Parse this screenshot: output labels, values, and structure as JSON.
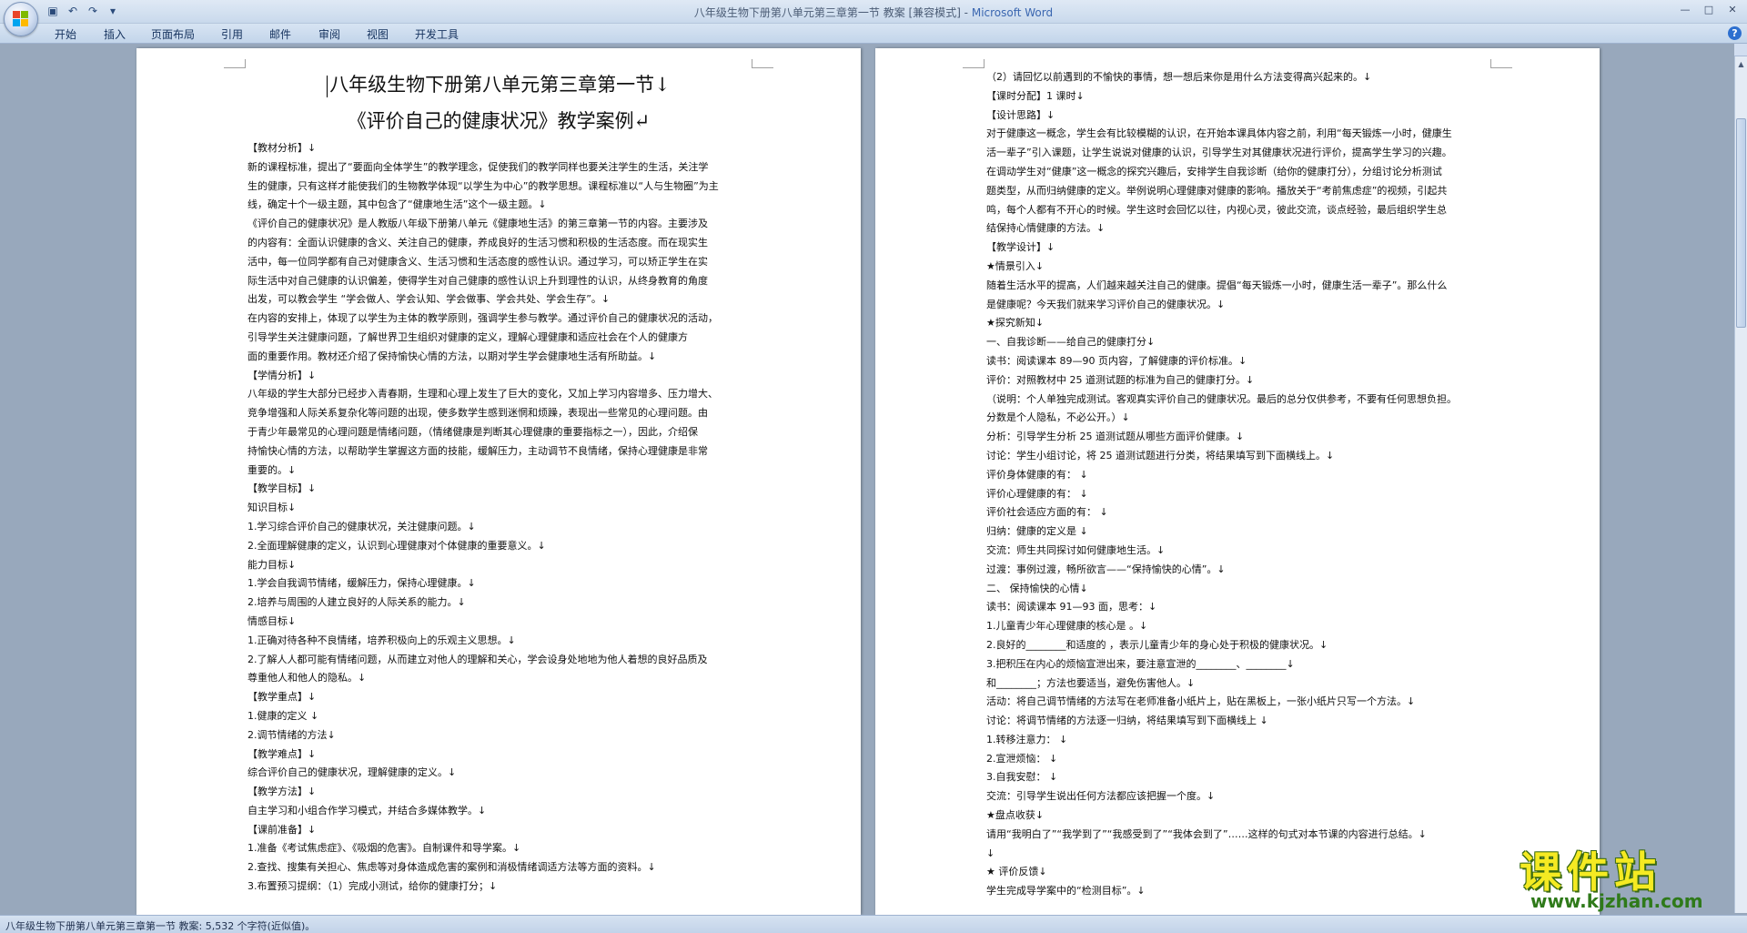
{
  "titlebar": {
    "title": "八年级生物下册第八单元第三章第一节 教案 [兼容模式] - ",
    "app": "Microsoft Word"
  },
  "icons": {
    "save": "save-icon",
    "undo": "undo-icon",
    "redo": "redo-icon",
    "customize": "chevron-down-icon",
    "help": "help-icon"
  },
  "tabs": [
    "开始",
    "插入",
    "页面布局",
    "引用",
    "邮件",
    "审阅",
    "视图",
    "开发工具"
  ],
  "page1": {
    "title_line1": "八年级生物下册第八单元第三章第一节↓",
    "title_line2": "《评价自己的健康状况》教学案例↵",
    "lines": [
      "【教材分析】↓",
      "新的课程标准，提出了“要面向全体学生”的教学理念，促使我们的教学同样也要关注学生的生活，关注学",
      "生的健康，只有这样才能使我们的生物教学体现“以学生为中心”的教学思想。课程标准以“人与生物圈”为主",
      "线，确定十个一级主题，其中包含了“健康地生活”这个一级主题。↓",
      "《评价自己的健康状况》是人教版八年级下册第八单元《健康地生活》的第三章第一节的内容。主要涉及",
      "的内容有：全面认识健康的含义、关注自己的健康，养成良好的生活习惯和积极的生活态度。而在现实生",
      "活中，每一位同学都有自己对健康含义、生活习惯和生活态度的感性认识。通过学习，可以矫正学生在实",
      "际生活中对自己健康的认识偏差，使得学生对自己健康的感性认识上升到理性的认识，从终身教育的角度",
      "出发，可以教会学生 “学会做人、学会认知、学会做事、学会共处、学会生存”。↓",
      "在内容的安排上，体现了以学生为主体的教学原则，强调学生参与教学。通过评价自己的健康状况的活动，",
      "引导学生关注健康问题，了解世界卫生组织对健康的定义，理解心理健康和适应社会在个人的健康方",
      "面的重要作用。教材还介绍了保持愉快心情的方法，以期对学生学会健康地生活有所助益。↓",
      "【学情分析】↓",
      "八年级的学生大部分已经步入青春期，生理和心理上发生了巨大的变化，又加上学习内容增多、压力增大、",
      "竞争增强和人际关系复杂化等问题的出现，使多数学生感到迷惘和烦躁，表现出一些常见的心理问题。由",
      "于青少年最常见的心理问题是情绪问题，（情绪健康是判断其心理健康的重要指标之一），因此，介绍保",
      "持愉快心情的方法，以帮助学生掌握这方面的技能，缓解压力，主动调节不良情绪，保持心理健康是非常",
      "重要的。↓",
      "【教学目标】↓",
      "知识目标↓",
      "1.学习综合评价自己的健康状况，关注健康问题。↓",
      "2.全面理解健康的定义，认识到心理健康对个体健康的重要意义。↓",
      "能力目标↓",
      "1.学会自我调节情绪，缓解压力，保持心理健康。↓",
      "2.培养与周围的人建立良好的人际关系的能力。↓",
      "情感目标↓",
      "1.正确对待各种不良情绪，培养积极向上的乐观主义思想。↓",
      "2.了解人人都可能有情绪问题，从而建立对他人的理解和关心，学会设身处地地为他人着想的良好品质及",
      "尊重他人和他人的隐私。↓",
      "【教学重点】↓",
      "1.健康的定义 ↓",
      "2.调节情绪的方法↓",
      "【教学难点】↓",
      "综合评价自己的健康状况，理解健康的定义。↓",
      "【教学方法】↓",
      "自主学习和小组合作学习模式，并结合多媒体教学。↓",
      "【课前准备】↓",
      "1.准备《考试焦虑症》、《吸烟的危害》。自制课件和导学案。↓",
      "2.查找、搜集有关担心、焦虑等对身体造成危害的案例和消极情绪调适方法等方面的资料。↓",
      "3.布置预习提纲：（1）完成小测试，给你的健康打分；↓"
    ]
  },
  "page2": {
    "lines": [
      "（2）请回忆以前遇到的不愉快的事情，想一想后来你是用什么方法变得高兴起来的。↓",
      "【课时分配】1 课时↓",
      "【设计思路】↓",
      "对于健康这一概念，学生会有比较模糊的认识，在开始本课具体内容之前，利用“每天锻炼一小时，健康生",
      "活一辈子”引入课题，让学生说说对健康的认识，引导学生对其健康状况进行评价，提高学生学习的兴趣。",
      "在调动学生对“健康”这一概念的探究兴趣后，安排学生自我诊断（给你的健康打分），分组讨论分析测试",
      "题类型，从而归纳健康的定义。举例说明心理健康对健康的影响。播放关于“考前焦虑症”的视频，引起共",
      "鸣，每个人都有不开心的时候。学生这时会回忆以往，内视心灵，彼此交流，谈点经验，最后组织学生总",
      "结保持心情健康的方法。↓",
      "【教学设计】↓",
      "★情景引入↓",
      "随着生活水平的提高，人们越来越关注自己的健康。提倡“每天锻炼一小时，健康生活一辈子”。那么什么",
      "是健康呢？今天我们就来学习评价自己的健康状况。↓",
      "★探究新知↓",
      "一、自我诊断——给自己的健康打分↓",
      "读书：阅读课本 89—90 页内容，了解健康的评价标准。↓",
      "评价：对照教材中 25 道测试题的标准为自己的健康打分。↓",
      "（说明：个人单独完成测试。客观真实评价自己的健康状况。最后的总分仅供参考，不要有任何思想负担。",
      "分数是个人隐私，不必公开。）↓",
      "分析：引导学生分析 25 道测试题从哪些方面评价健康。↓",
      "讨论：学生小组讨论，将 25 道测试题进行分类，将结果填写到下面横线上。↓",
      "评价身体健康的有： ↓",
      "评价心理健康的有： ↓",
      "    评价社会适应方面的有： ↓",
      "归纳：健康的定义是 ↓",
      "交流：师生共同探讨如何健康地生活。↓",
      "过渡：事例过渡，畅所欲言——“保持愉快的心情”。↓",
      "二、 保持愉快的心情↓",
      "读书：阅读课本 91—93 面，思考：↓",
      "1.儿童青少年心理健康的核心是 。↓",
      "2.良好的________和适度的 ，表示儿童青少年的身心处于积极的健康状况。↓",
      "3.把积压在内心的烦恼宣泄出来，要注意宣泄的________、________↓",
      "和________；方法也要适当，避免伤害他人。↓",
      "活动：将自己调节情绪的方法写在老师准备小纸片上，贴在黑板上，一张小纸片只写一个方法。↓",
      "讨论：将调节情绪的方法逐一归纳，将结果填写到下面横线上 ↓",
      "1.转移注意力： ↓",
      "2.宣泄烦恼： ↓",
      "3.自我安慰： ↓",
      "交流：引导学生说出任何方法都应该把握一个度。↓",
      "★盘点收获↓",
      "请用“我明白了”“我学到了”“我感受到了”“我体会到了”……这样的句式对本节课的内容进行总结。↓",
      "↓",
      "★ 评价反馈↓",
      "学生完成导学案中的“检测目标”。↓"
    ]
  },
  "statusbar": {
    "text": "八年级生物下册第八单元第三章第一节 教案: 5,532 个字符(近似值)。"
  },
  "watermark": {
    "name": "课件站",
    "url": "www.kjzhan.com"
  }
}
